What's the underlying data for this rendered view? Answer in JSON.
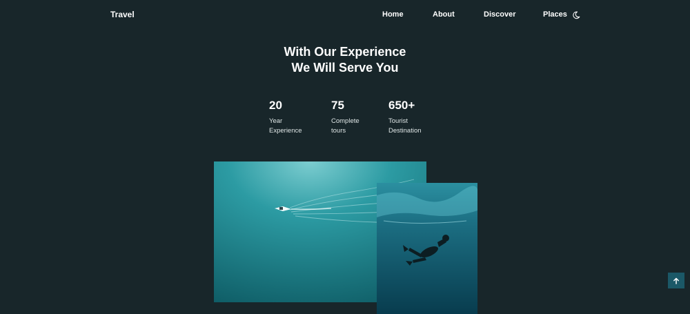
{
  "header": {
    "logo": "Travel",
    "nav": [
      {
        "label": "Home"
      },
      {
        "label": "About"
      },
      {
        "label": "Discover"
      },
      {
        "label": "Places"
      }
    ],
    "theme_toggle_icon": "moon-icon"
  },
  "hero": {
    "title_line1": "With Our Experience",
    "title_line2": "We Will Serve You"
  },
  "stats": [
    {
      "value": "20",
      "label_line1": "Year",
      "label_line2": "Experience"
    },
    {
      "value": "75",
      "label_line1": "Complete",
      "label_line2": "tours"
    },
    {
      "value": "650+",
      "label_line1": "Tourist",
      "label_line2": "Destination"
    }
  ],
  "images": {
    "primary": "boat-on-ocean-photo",
    "secondary": "underwater-diver-photo"
  },
  "scroll_up_icon": "arrow-up-icon",
  "colors": {
    "background": "#18262a",
    "text": "#ffffff",
    "accent": "#1b5867"
  }
}
